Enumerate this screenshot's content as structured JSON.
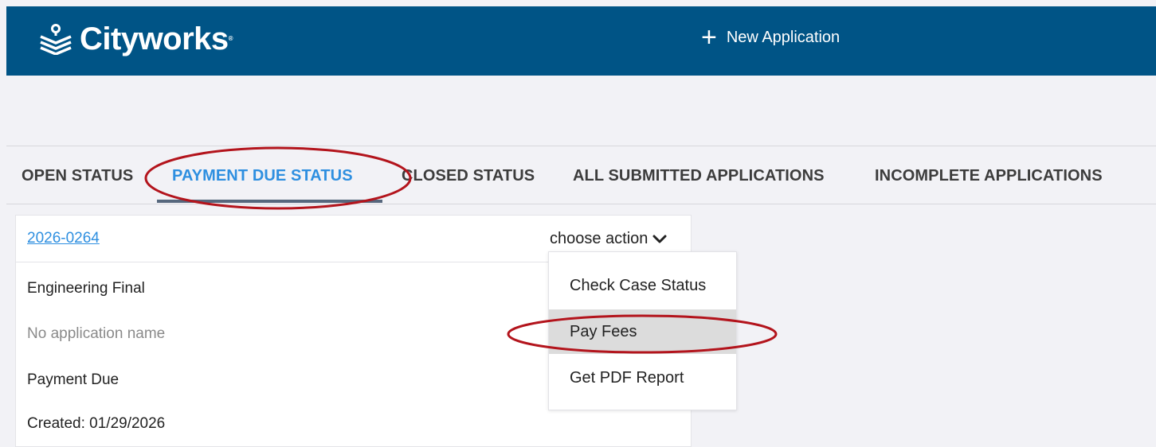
{
  "header": {
    "brand": "Cityworks",
    "brand_mark": "®",
    "logo_icon": "cityworks-logo-icon",
    "new_application_label": "New Application",
    "bg_color": "#005486"
  },
  "tabs": [
    {
      "label": "OPEN STATUS",
      "active": false
    },
    {
      "label": "PAYMENT DUE STATUS",
      "active": true
    },
    {
      "label": "CLOSED STATUS",
      "active": false
    },
    {
      "label": "ALL SUBMITTED APPLICATIONS",
      "active": false
    },
    {
      "label": "INCOMPLETE APPLICATIONS",
      "active": false
    }
  ],
  "case_card": {
    "case_number": "2026-0264",
    "action_label": "choose action",
    "type": "Engineering Final",
    "application_name": "No application name",
    "status": "Payment Due",
    "created": "Created: 01/29/2026"
  },
  "action_menu": {
    "items": [
      {
        "label": "Check Case Status",
        "hovered": false
      },
      {
        "label": "Pay Fees",
        "hovered": true
      },
      {
        "label": "Get PDF Report",
        "hovered": false
      }
    ]
  },
  "annotations": {
    "highlight_color": "#b3141c"
  },
  "colors": {
    "accent": "#2e8fe0",
    "tab_underline": "#56677d",
    "page_bg": "#f2f2f6"
  }
}
